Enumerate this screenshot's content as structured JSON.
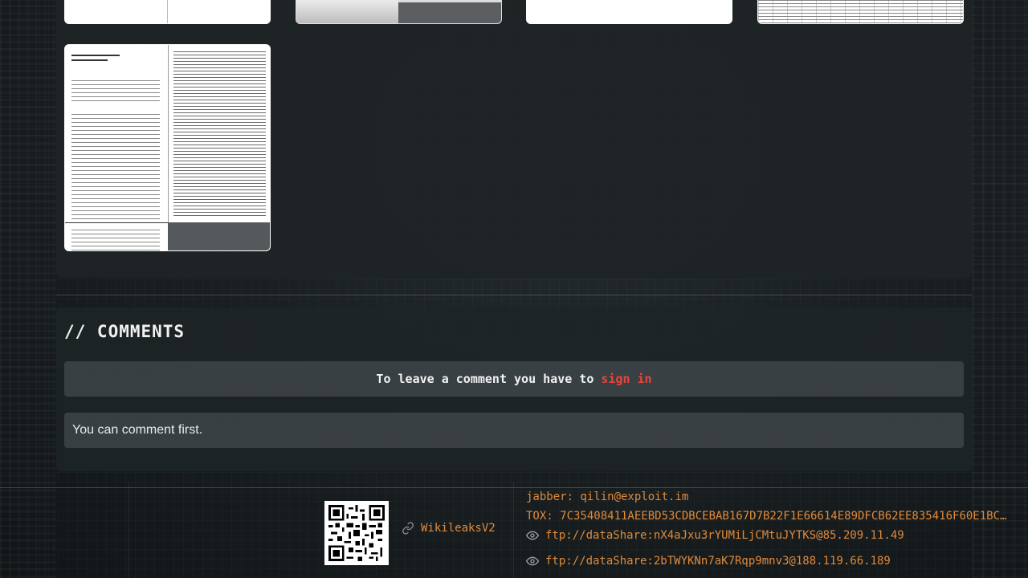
{
  "comments": {
    "title": "// COMMENTS",
    "signin_prompt": "To leave a comment you have to",
    "signin_link": "sign in",
    "empty_message": "You can comment first."
  },
  "footer": {
    "wiki_label": "WikileaksV2",
    "jabber": "jabber: qilin@exploit.im",
    "tox": "TOX: 7C35408411AEEBD53CDBCEBAB167D7B22F1E66614E89DFCB62EE835416F60E1BC…",
    "ftp_links": [
      "ftp://dataShare:nX4aJxu3rYUMiLjCMtuJYTKS@85.209.11.49",
      "ftp://dataShare:2bTWYKNn7aK7Rqp9mnv3@188.119.66.189"
    ],
    "icons": {
      "link": "link-icon",
      "eye": "eye-icon",
      "qr": "qr-code"
    }
  },
  "colors": {
    "accent_orange": "#e08a3c",
    "link_red": "#e8453c",
    "panel": "#1e2426"
  }
}
